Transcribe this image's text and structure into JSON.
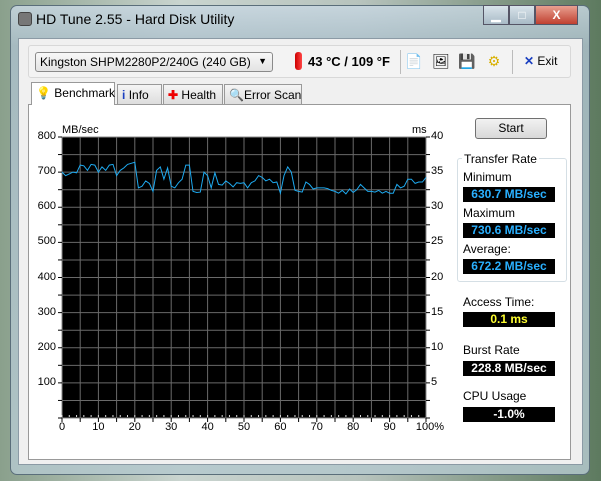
{
  "window": {
    "title": "HD Tune 2.55 - Hard Disk Utility",
    "minimize": "▁",
    "maximize": "□",
    "close": "X"
  },
  "toolbar": {
    "drive": "Kingston SHPM2280P2/240G (240 GB)",
    "temperature": "43 °C / 109 °F",
    "exit": "Exit"
  },
  "tabs": [
    {
      "label": "Benchmark"
    },
    {
      "label": "Info"
    },
    {
      "label": "Health"
    },
    {
      "label": "Error Scan"
    }
  ],
  "side": {
    "start": "Start",
    "transfer_rate": "Transfer Rate",
    "minimum_label": "Minimum",
    "minimum": "630.7 MB/sec",
    "maximum_label": "Maximum",
    "maximum": "730.6 MB/sec",
    "average_label": "Average:",
    "average": "672.2 MB/sec",
    "access_label": "Access Time:",
    "access": "0.1 ms",
    "burst_label": "Burst Rate",
    "burst": "228.8 MB/sec",
    "cpu_label": "CPU Usage",
    "cpu": "-1.0%"
  },
  "chart_data": {
    "type": "line",
    "ylabel": "MB/sec",
    "y2label": "ms",
    "ylim": [
      0,
      800
    ],
    "y2lim": [
      0,
      40
    ],
    "xlim": [
      0,
      100
    ],
    "grid": true,
    "yticks": [
      "800",
      "700",
      "600",
      "500",
      "400",
      "300",
      "200",
      "100"
    ],
    "y2ticks": [
      "40",
      "35",
      "30",
      "25",
      "20",
      "15",
      "10",
      "5"
    ],
    "xticks": [
      "0",
      "10",
      "20",
      "30",
      "40",
      "50",
      "60",
      "70",
      "80",
      "90",
      "100%"
    ],
    "series": [
      {
        "name": "Transfer rate",
        "color": "#1eaaf0",
        "values": [
          700,
          690,
          695,
          700,
          698,
          720,
          718,
          705,
          722,
          720,
          700,
          715,
          705,
          720,
          722,
          690,
          705,
          712,
          722,
          725,
          728,
          655,
          660,
          675,
          668,
          645,
          705,
          715,
          680,
          712,
          660,
          655,
          670,
          680,
          720,
          720,
          645,
          642,
          643,
          700,
          690,
          655,
          698,
          665,
          663,
          675,
          668,
          658,
          670,
          668,
          670,
          655,
          670,
          675,
          690,
          685,
          675,
          680,
          670,
          672,
          640,
          690,
          715,
          700,
          648,
          645,
          643,
          672,
          665,
          652,
          655,
          655,
          655,
          653,
          648,
          645,
          640,
          648,
          638,
          652,
          642,
          650,
          665,
          655,
          645,
          645,
          643,
          648,
          640,
          645,
          640,
          640,
          665,
          655,
          660,
          680,
          680,
          668,
          672,
          672,
          685
        ]
      }
    ]
  }
}
